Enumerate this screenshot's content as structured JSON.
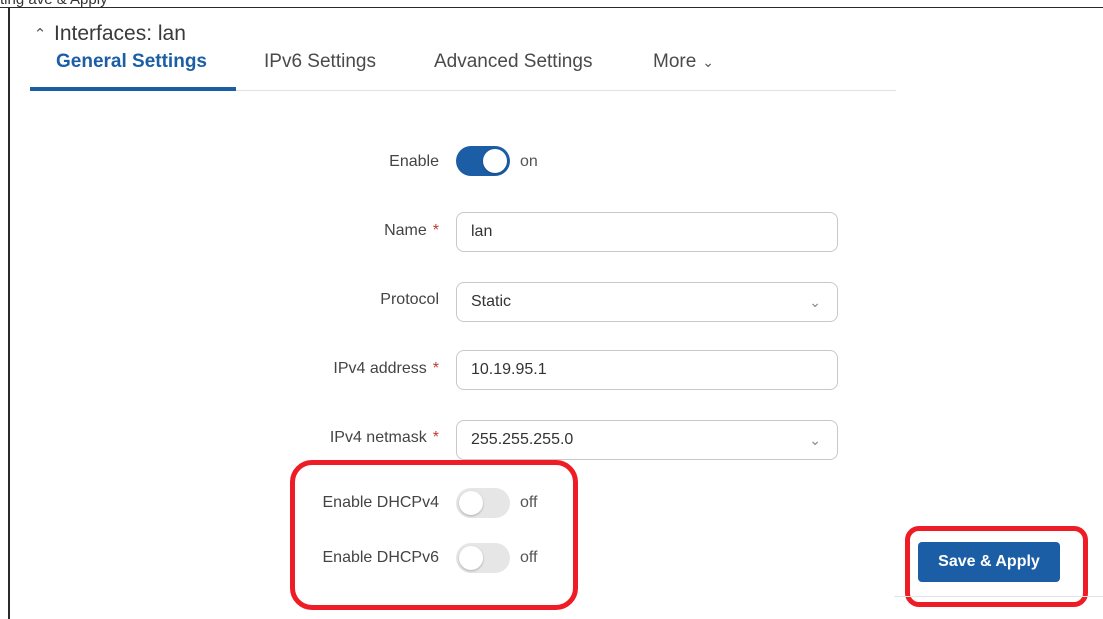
{
  "header": {
    "cutoff_text": "ting  ave & Apply",
    "title": "Interfaces: lan"
  },
  "tabs": [
    {
      "label": "General Settings",
      "active": true
    },
    {
      "label": "IPv6 Settings",
      "active": false
    },
    {
      "label": "Advanced Settings",
      "active": false
    },
    {
      "label": "More",
      "active": false
    }
  ],
  "form": {
    "enable": {
      "label": "Enable",
      "state": "on"
    },
    "name": {
      "label": "Name",
      "required": "*",
      "value": "lan"
    },
    "protocol": {
      "label": "Protocol",
      "value": "Static"
    },
    "ipv4_address": {
      "label": "IPv4 address",
      "required": "*",
      "value": "10.19.95.1"
    },
    "ipv4_netmask": {
      "label": "IPv4 netmask",
      "required": "*",
      "value": "255.255.255.0"
    },
    "dhcpv4": {
      "label": "Enable DHCPv4",
      "state": "off"
    },
    "dhcpv6": {
      "label": "Enable DHCPv6",
      "state": "off"
    }
  },
  "actions": {
    "save_apply": "Save & Apply"
  },
  "colors": {
    "accent": "#1b5ea6",
    "highlight": "#ee1c25",
    "required": "#c0392b"
  },
  "icons": {
    "collapse": "chevron-up-icon",
    "more": "chevron-down-icon",
    "select": "chevron-down-icon"
  }
}
